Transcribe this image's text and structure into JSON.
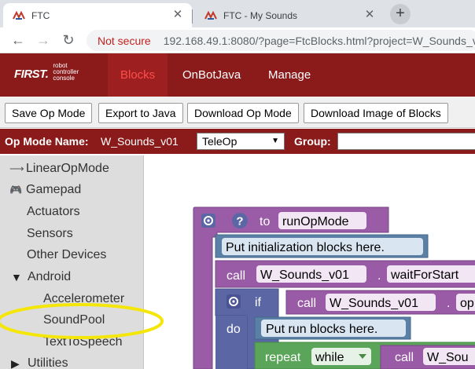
{
  "browser": {
    "tabs": [
      {
        "title": "FTC",
        "active": true
      },
      {
        "title": "FTC - My Sounds",
        "active": false
      }
    ],
    "new_tab_glyph": "+",
    "close_glyph": "✕",
    "security_label": "Not secure",
    "url": "192.168.49.1:8080/?page=FtcBlocks.html?project=W_Sounds_v01"
  },
  "header": {
    "logo_main": "FIRST.",
    "logo_line1": "robot",
    "logo_line2": "controller",
    "logo_line3": "console",
    "nav": [
      "Blocks",
      "OnBotJava",
      "Manage"
    ],
    "active_nav": "Blocks"
  },
  "actions": {
    "save": "Save Op Mode",
    "export": "Export to Java",
    "download": "Download Op Mode",
    "download_image": "Download Image of Blocks"
  },
  "opmode": {
    "name_label": "Op Mode Name:",
    "name_value": "W_Sounds_v01",
    "type_selected": "TeleOp",
    "group_label": "Group:",
    "group_value": ""
  },
  "toolbox": {
    "categories": [
      {
        "label": "LinearOpMode",
        "icon": "arrow-right-icon"
      },
      {
        "label": "Gamepad",
        "icon": "gamepad-icon"
      },
      {
        "label": "Actuators",
        "icon": ""
      },
      {
        "label": "Sensors",
        "icon": ""
      },
      {
        "label": "Other Devices",
        "icon": ""
      },
      {
        "label": "Android",
        "icon": "triangle-down-icon"
      },
      {
        "label": "Accelerometer",
        "icon": ""
      },
      {
        "label": "SoundPool",
        "icon": ""
      },
      {
        "label": "TextToSpeech",
        "icon": ""
      },
      {
        "label": "Utilities",
        "icon": "triangle-right-icon"
      }
    ]
  },
  "blocks": {
    "to": "to",
    "func_name": "runOpMode",
    "comment_init": "Put initialization blocks here.",
    "call1": "call",
    "call1_target": "W_Sounds_v01",
    "call1_dot": ".",
    "call1_method": "waitForStart",
    "if_label": "if",
    "call2": "call",
    "call2_target": "W_Sounds_v01",
    "call2_dot": ".",
    "call2_method": "op",
    "do_label": "do",
    "comment_run": "Put run blocks here.",
    "repeat_label": "repeat",
    "repeat_mode": "while",
    "call3": "call",
    "call3_target": "W_Sou"
  },
  "colors": {
    "header_red": "#8b1a1a",
    "active_nav_text": "#ff4d4d",
    "procedure_block": "#9a5ca6",
    "method_block": "#995ba5",
    "comment_block": "#5b80a5",
    "loop_block": "#5ba55b",
    "highlight_ellipse": "#f5e60a"
  }
}
